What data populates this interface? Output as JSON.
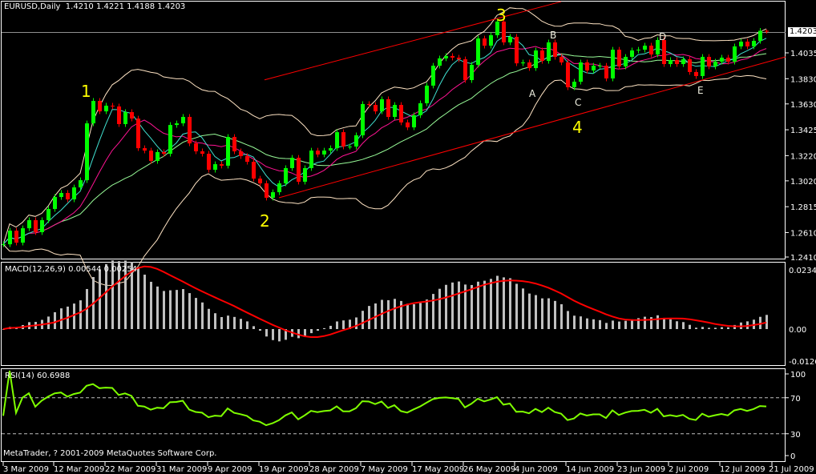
{
  "header": {
    "symbol": "EURUSD,Daily",
    "ohlc": "1.4210 1.4221 1.4188 1.4203"
  },
  "macd_label": "MACD(12,26,9) 0.00544 0.00254",
  "rsi_label": "RSI(14) 60.6988",
  "copyright": "MetaTrader, ? 2001-2009 MetaQuotes Software Corp.",
  "current_price": "1.4203",
  "colors": {
    "bull": "#00ff00",
    "bear": "#ff0000",
    "bands": "#ffe4c4",
    "ma_fast": "#40e0d0",
    "ma_mid": "#ff1493",
    "ma_slow": "#98fb98",
    "trendline": "#ff0000",
    "macd_hist": "#c0c0c0",
    "macd_signal": "#ff0000",
    "rsi": "#7fff00",
    "wave_labels": "#ffff00"
  },
  "annotations": {
    "w1": "1",
    "w2": "2",
    "w3": "3",
    "w4": "4",
    "a": "A",
    "b": "B",
    "c": "C",
    "d": "D",
    "e": "E"
  },
  "price_axis": [
    "1.4210",
    "1.4035",
    "1.3830",
    "1.3630",
    "1.3425",
    "1.3220",
    "1.3020",
    "1.2815",
    "1.2610",
    "1.2410"
  ],
  "macd_axis": [
    "0.02345",
    "0.00",
    "-0.01265"
  ],
  "rsi_axis": [
    "100",
    "70",
    "30",
    "0"
  ],
  "time_axis": [
    "3 Mar 2009",
    "12 Mar 2009",
    "22 Mar 2009",
    "31 Mar 2009",
    "9 Apr 2009",
    "19 Apr 2009",
    "28 Apr 2009",
    "7 May 2009",
    "17 May 2009",
    "26 May 2009",
    "4 Jun 2009",
    "14 Jun 2009",
    "23 Jun 2009",
    "2 Jul 2009",
    "12 Jul 2009",
    "21 Jul 2009"
  ],
  "chart_data": {
    "type": "candlestick",
    "price_range": [
      1.241,
      1.424
    ],
    "closes": [
      1.2517,
      1.2625,
      1.253,
      1.2644,
      1.2708,
      1.2613,
      1.2708,
      1.2797,
      1.2892,
      1.2924,
      1.2873,
      1.2968,
      1.3025,
      1.3476,
      1.3654,
      1.3571,
      1.3616,
      1.361,
      1.347,
      1.3565,
      1.3514,
      1.3279,
      1.326,
      1.3178,
      1.3248,
      1.3235,
      1.3463,
      1.3476,
      1.3527,
      1.3317,
      1.3254,
      1.3235,
      1.3108,
      1.3152,
      1.314,
      1.3368,
      1.3254,
      1.3216,
      1.3171,
      1.3038,
      1.3,
      1.2886,
      1.293,
      1.3,
      1.3121,
      1.3203,
      1.3013,
      1.3121,
      1.326,
      1.3229,
      1.326,
      1.3279,
      1.3406,
      1.3292,
      1.3292,
      1.3381,
      1.3629,
      1.3622,
      1.3571,
      1.3667,
      1.3527,
      1.3622,
      1.3483,
      1.3444,
      1.354,
      1.3635,
      1.3775,
      1.3933,
      1.3991,
      1.401,
      1.3997,
      1.3984,
      1.3819,
      1.394,
      1.4149,
      1.4092,
      1.4175,
      1.4283,
      1.4118,
      1.4162,
      1.3952,
      1.3959,
      1.3914,
      1.4054,
      1.3971,
      1.4118,
      1.4003,
      1.3959,
      1.3762,
      1.3806,
      1.3959,
      1.3895,
      1.3933,
      1.3933,
      1.3832,
      1.406,
      1.3927,
      1.4003,
      1.4054,
      1.406,
      1.4092,
      1.4022,
      1.4137,
      1.3946,
      1.3978,
      1.3946,
      1.3984,
      1.3883,
      1.3851,
      1.4003,
      1.3927,
      1.3965,
      1.3997,
      1.3965,
      1.4086,
      1.4124,
      1.4086,
      1.413,
      1.421,
      1.4203
    ],
    "last_bar": {
      "open": 1.421,
      "high": 1.4221,
      "low": 1.4188,
      "close": 1.4203
    },
    "indicators": {
      "bollinger": [
        20,
        2
      ],
      "ma_periods": [
        5,
        10,
        21
      ],
      "macd": [
        12,
        26,
        9
      ],
      "rsi": 14,
      "rsi_levels": [
        70,
        30
      ]
    },
    "trendlines": [
      {
        "from": [
          40.75,
          1.3821
        ],
        "to": [
          87,
          1.4441
        ]
      },
      {
        "from": [
          43,
          1.2886
        ],
        "to": [
          122,
          1.4003
        ]
      }
    ],
    "macd_range": [
      -0.01265,
      0.02345
    ],
    "rsi_range": [
      0,
      100
    ]
  }
}
